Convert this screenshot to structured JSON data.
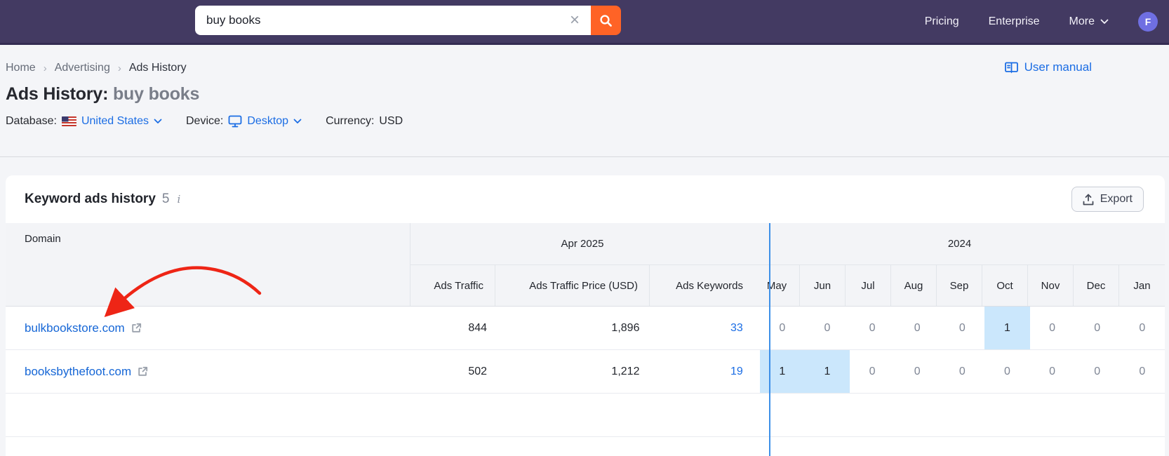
{
  "navbar": {
    "search": {
      "value": "buy books",
      "clear_glyph": "×"
    },
    "links": [
      {
        "label": "Pricing"
      },
      {
        "label": "Enterprise"
      },
      {
        "label": "More"
      }
    ],
    "avatar_initial": "F"
  },
  "breadcrumb": {
    "separator": "›",
    "items": [
      "Home",
      "Advertising",
      "Ads History"
    ]
  },
  "user_manual_label": "User manual",
  "page_title": {
    "prefix": "Ads History:",
    "keyword": "buy books"
  },
  "filters": {
    "database_label": "Database:",
    "database_value": "United States",
    "device_label": "Device:",
    "device_value": "Desktop",
    "currency_label": "Currency:",
    "currency_value": "USD"
  },
  "card": {
    "title": "Keyword ads history",
    "count": "5",
    "info_icon_glyph": "i",
    "export_label": "Export"
  },
  "table": {
    "domain_header": "Domain",
    "groups": {
      "apr": "Apr 2025",
      "y2024": "2024"
    },
    "value_headers": [
      "Ads Traffic",
      "Ads Traffic Price (USD)",
      "Ads Keywords"
    ],
    "month_headers": [
      "May",
      "Jun",
      "Jul",
      "Aug",
      "Sep",
      "Oct",
      "Nov",
      "Dec",
      "Jan"
    ],
    "rows": [
      {
        "domain": "bulkbookstore.com",
        "ads_traffic": "844",
        "ads_traffic_price": "1,896",
        "ads_keywords": "33",
        "months": [
          {
            "v": "0",
            "hl": false
          },
          {
            "v": "0",
            "hl": false
          },
          {
            "v": "0",
            "hl": false
          },
          {
            "v": "0",
            "hl": false
          },
          {
            "v": "0",
            "hl": false
          },
          {
            "v": "1",
            "hl": true
          },
          {
            "v": "0",
            "hl": false
          },
          {
            "v": "0",
            "hl": false
          },
          {
            "v": "0",
            "hl": false
          }
        ]
      },
      {
        "domain": "booksbythefoot.com",
        "ads_traffic": "502",
        "ads_traffic_price": "1,212",
        "ads_keywords": "19",
        "months": [
          {
            "v": "1",
            "hl": true
          },
          {
            "v": "1",
            "hl": true
          },
          {
            "v": "0",
            "hl": false
          },
          {
            "v": "0",
            "hl": false
          },
          {
            "v": "0",
            "hl": false
          },
          {
            "v": "0",
            "hl": false
          },
          {
            "v": "0",
            "hl": false
          },
          {
            "v": "0",
            "hl": false
          },
          {
            "v": "0",
            "hl": false
          }
        ]
      }
    ]
  },
  "colors": {
    "navbar_bg": "#433a62",
    "search_button_orange": "#ff6326",
    "link_blue": "#1b6de4",
    "highlight_cell_blue": "#cbe7fc",
    "column_marker_blue": "#3e90e8",
    "annotation_arrow_red": "#ee2516",
    "avatar_bg": "#6f6fe2",
    "page_bg": "#f4f5f8",
    "table_header_bg": "#f3f4f7"
  }
}
